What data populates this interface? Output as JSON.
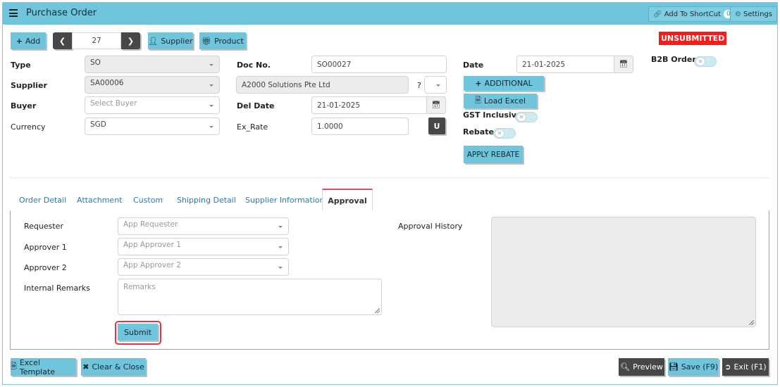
{
  "header": {
    "title": "Purchase Order",
    "shortcut_label": "Add To ShortCut",
    "shortcut_count": "0",
    "settings_label": "Settings"
  },
  "toolbar": {
    "add_label": "Add",
    "record_number": "27",
    "supplier_label": "Supplier",
    "product_label": "Product"
  },
  "status": {
    "label": "UNSUBMITTED",
    "color": "#ff1a1a"
  },
  "form": {
    "type_label": "Type",
    "type_value": "SO",
    "supplier_label": "Supplier",
    "supplier_value": "SA00006",
    "buyer_label": "Buyer",
    "buyer_placeholder": "Select Buyer",
    "currency_label": "Currency",
    "currency_value": "SGD",
    "docno_label": "Doc No.",
    "docno_value": "SO00027",
    "supplier_name_value": "A2000 Solutions Pte Ltd",
    "question_mark": "?",
    "deldate_label": "Del Date",
    "deldate_value": "21-01-2025",
    "exrate_label": "Ex_Rate",
    "exrate_value": "1.0000",
    "u_button": "U",
    "date_label": "Date",
    "date_value": "21-01-2025",
    "additional_label": "ADDITIONAL",
    "load_excel_label": "Load Excel",
    "gst_label": "GST Inclusive",
    "rebate_label": "Rebate",
    "apply_rebate_label": "APPLY REBATE",
    "b2b_label": "B2B Order"
  },
  "tabs": [
    {
      "label": "Order Detail"
    },
    {
      "label": "Attachment"
    },
    {
      "label": "Custom"
    },
    {
      "label": "Shipping Detail"
    },
    {
      "label": "Supplier Information"
    },
    {
      "label": "Approval"
    }
  ],
  "approval": {
    "requester_label": "Requester",
    "requester_placeholder": "App Requester",
    "approver1_label": "Approver 1",
    "approver1_placeholder": "App Approver 1",
    "approver2_label": "Approver 2",
    "approver2_placeholder": "App Approver 2",
    "remarks_label": "Internal Remarks",
    "remarks_placeholder": "Remarks",
    "submit_label": "Submit",
    "history_label": "Approval History"
  },
  "footer": {
    "excel_template_label": "Excel Template",
    "clear_close_label": "Clear & Close",
    "preview_label": "Preview",
    "save_label": "Save (F9)",
    "exit_label": "Exit (F1)"
  },
  "colors": {
    "accent": "#6ec5dc",
    "dark": "#474747",
    "highlight": "#e0353b"
  }
}
